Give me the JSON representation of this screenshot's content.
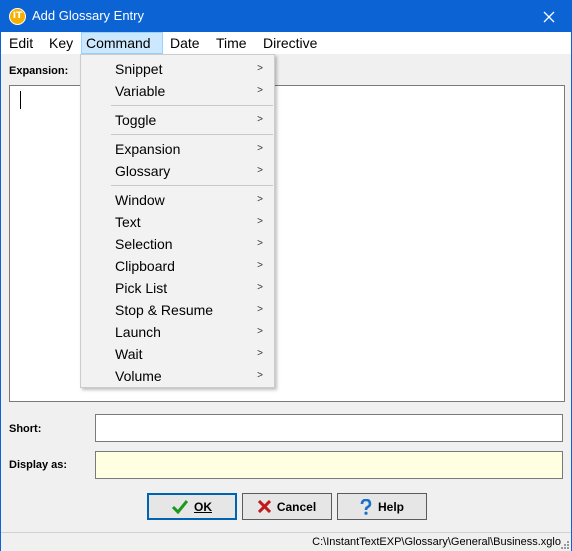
{
  "window": {
    "title": "Add Glossary Entry",
    "app_icon_text": "IT",
    "close_glyph": "✕"
  },
  "menubar": {
    "items": [
      "Edit",
      "Key",
      "Command",
      "Date",
      "Time",
      "Directive"
    ],
    "active": "Command"
  },
  "command_menu": {
    "groups": [
      [
        "Snippet",
        "Variable"
      ],
      [
        "Toggle"
      ],
      [
        "Expansion",
        "Glossary"
      ],
      [
        "Window",
        "Text",
        "Selection",
        "Clipboard",
        "Pick List",
        "Stop & Resume",
        "Launch",
        "Wait",
        "Volume"
      ]
    ],
    "submenu_glyph": ">"
  },
  "form": {
    "expansion_label": "Expansion:",
    "expansion_value": "",
    "short_label": "Short:",
    "short_value": "",
    "display_label": "Display as:",
    "display_value": ""
  },
  "buttons": {
    "ok": "OK",
    "cancel": "Cancel",
    "help": "Help"
  },
  "status": {
    "path": "C:\\InstantTextEXP\\Glossary\\General\\Business.xglo"
  },
  "colors": {
    "titlebar": "#0b63d4",
    "menu_highlight": "#cce8ff",
    "ok_check": "#1a9a1a",
    "cancel_x": "#c21a1a",
    "help_q": "#1a6fc9",
    "display_field": "#ffffe1"
  }
}
